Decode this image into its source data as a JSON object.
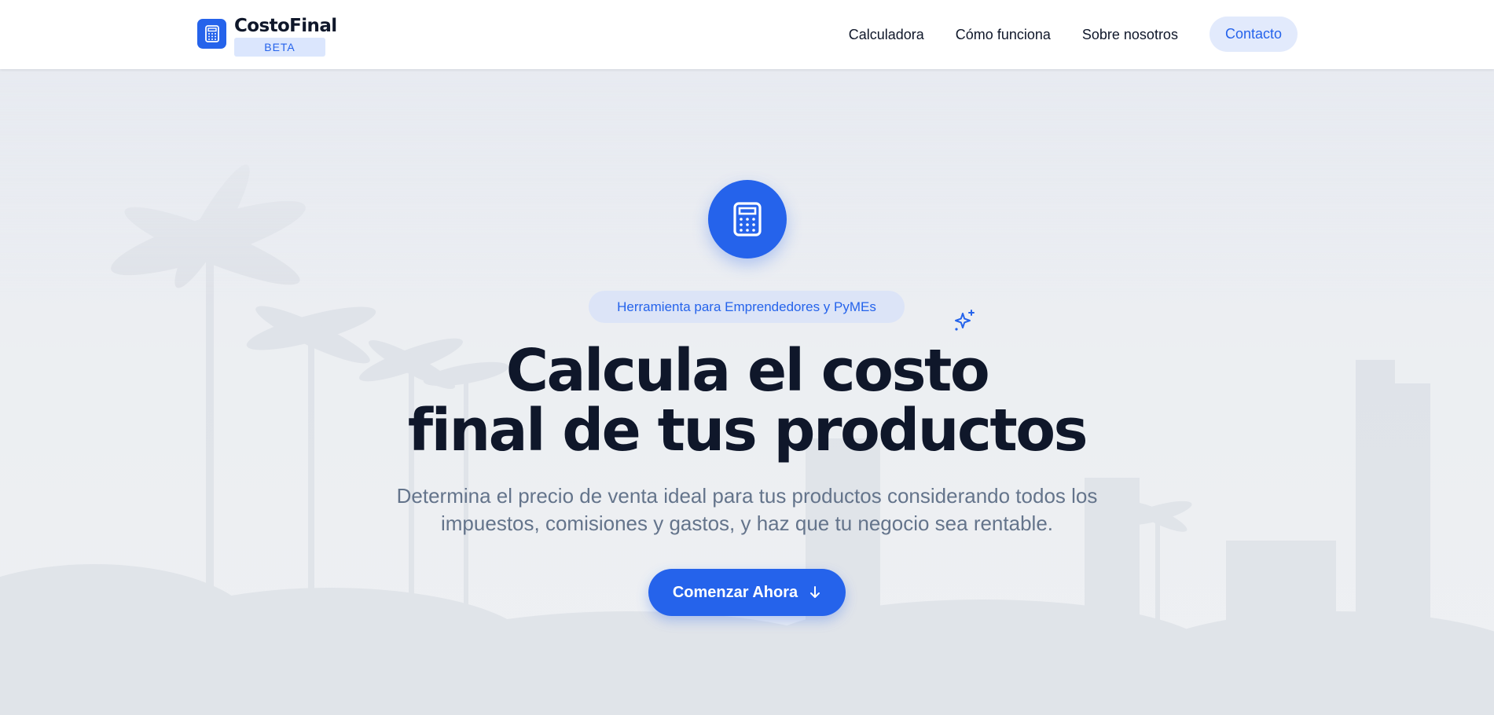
{
  "header": {
    "brand_name": "CostoFinal",
    "brand_badge": "BETA",
    "brand_icon": "calculator-icon",
    "nav": [
      {
        "label": "Calculadora"
      },
      {
        "label": "Cómo funciona"
      },
      {
        "label": "Sobre nosotros"
      }
    ],
    "contact_label": "Contacto"
  },
  "hero": {
    "icon": "calculator-icon",
    "badge": "Herramienta para Emprendedores y PyMEs",
    "sparkle_icon": "sparkles-icon",
    "title_line1": "Calcula el costo",
    "title_line2": "final de tus productos",
    "subtitle_line1": "Determina el precio de venta ideal para tus productos considerando todos los",
    "subtitle_line2": "impuestos, comisiones y gastos, y haz que tu negocio sea rentable.",
    "cta_label": "Comenzar Ahora",
    "cta_icon": "arrow-down-icon"
  },
  "colors": {
    "accent": "#2563eb",
    "accent_soft": "#dce4f7",
    "heading": "#0f172a",
    "muted_text": "#64748b",
    "header_bg": "#ffffff"
  }
}
